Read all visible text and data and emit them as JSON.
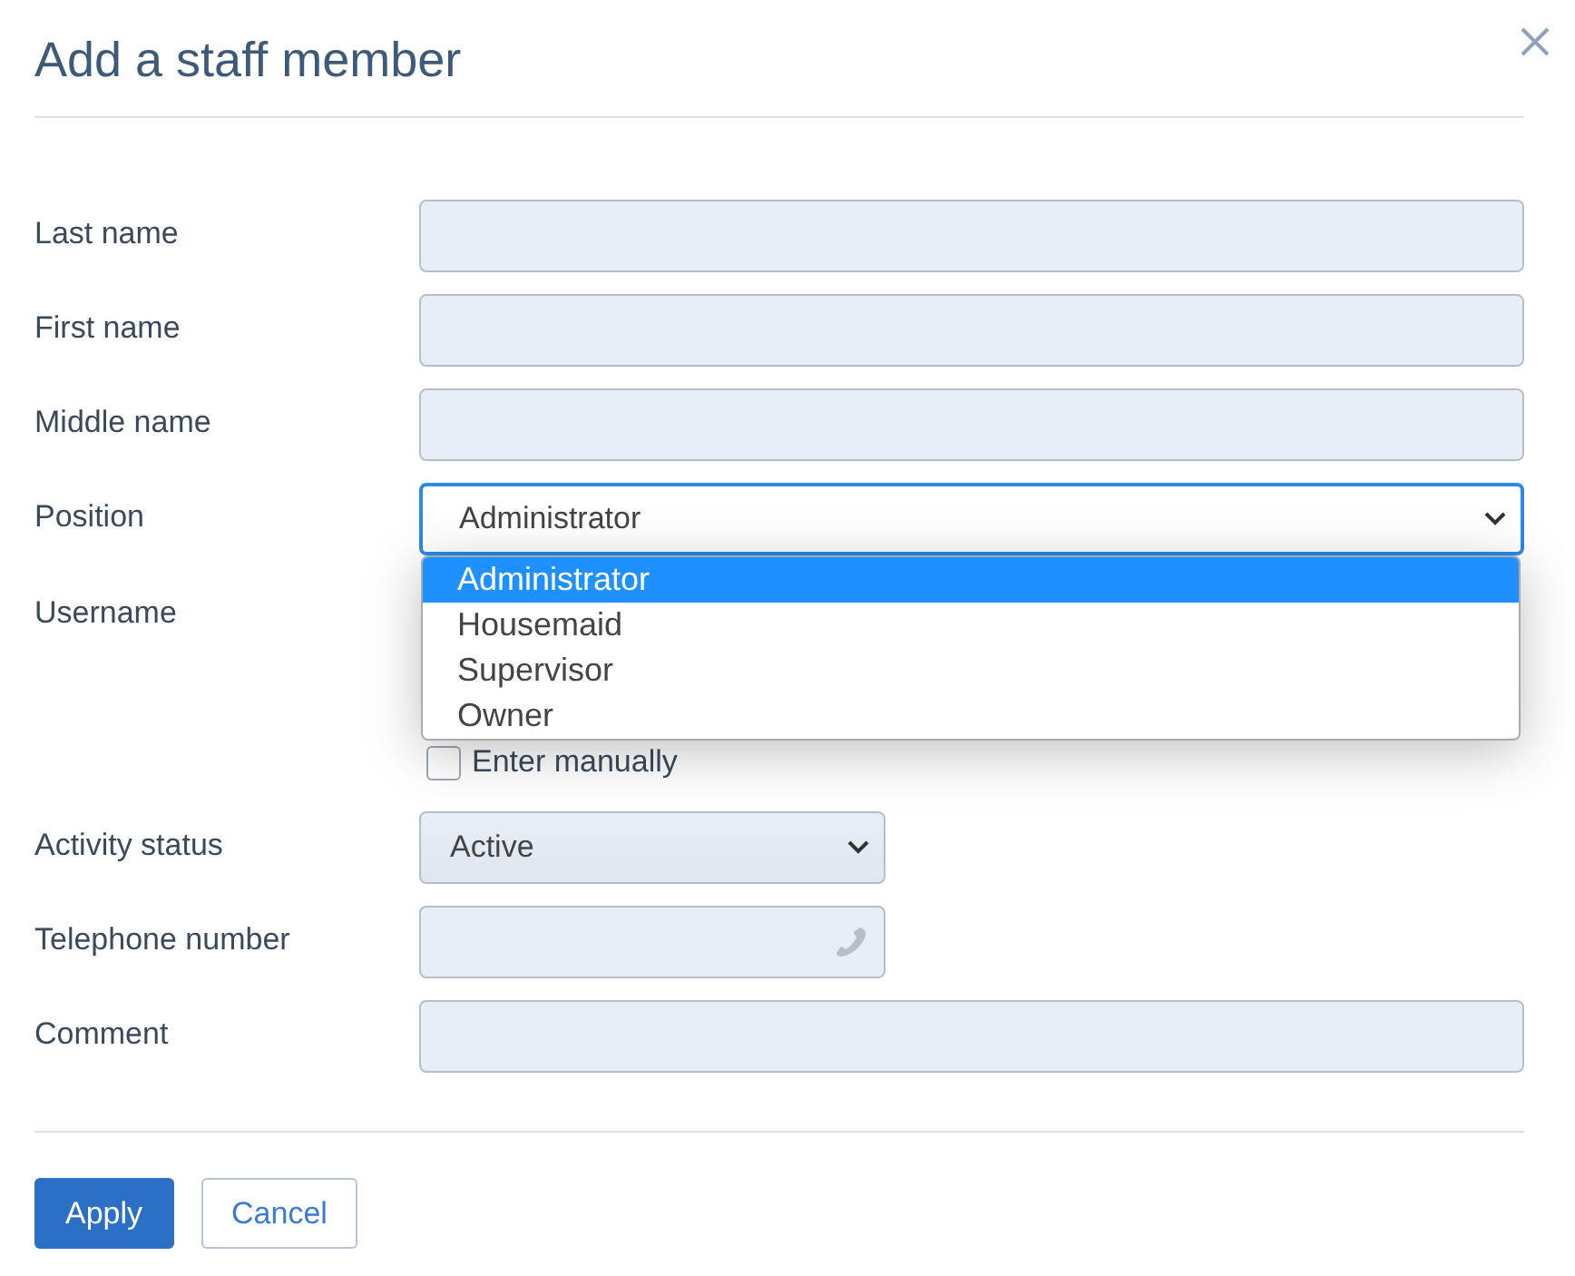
{
  "dialog": {
    "title": "Add a staff member"
  },
  "fields": [
    {
      "kind": "text",
      "label": "Last name",
      "wide": true
    },
    {
      "kind": "text",
      "label": "First name",
      "wide": true
    },
    {
      "kind": "text",
      "label": "Middle name",
      "wide": true
    },
    {
      "kind": "select",
      "label": "Position",
      "value": "Administrator",
      "wide": true,
      "expanded": true,
      "options": [
        {
          "label": "Administrator",
          "selected": true
        },
        {
          "label": "Housemaid",
          "selected": false
        },
        {
          "label": "Supervisor",
          "selected": false
        },
        {
          "label": "Owner",
          "selected": false
        }
      ]
    },
    {
      "kind": "username",
      "label": "Username",
      "checkbox": {
        "label": "Enter manually",
        "checked": false
      }
    },
    {
      "kind": "select",
      "label": "Activity status",
      "value": "Active",
      "wide": false,
      "expanded": false
    },
    {
      "kind": "phone",
      "label": "Telephone number",
      "wide": false
    },
    {
      "kind": "text",
      "label": "Comment",
      "wide": true
    }
  ],
  "buttons": [
    {
      "label": "Apply",
      "kind": "primary"
    },
    {
      "label": "Cancel",
      "kind": "secondary"
    }
  ]
}
